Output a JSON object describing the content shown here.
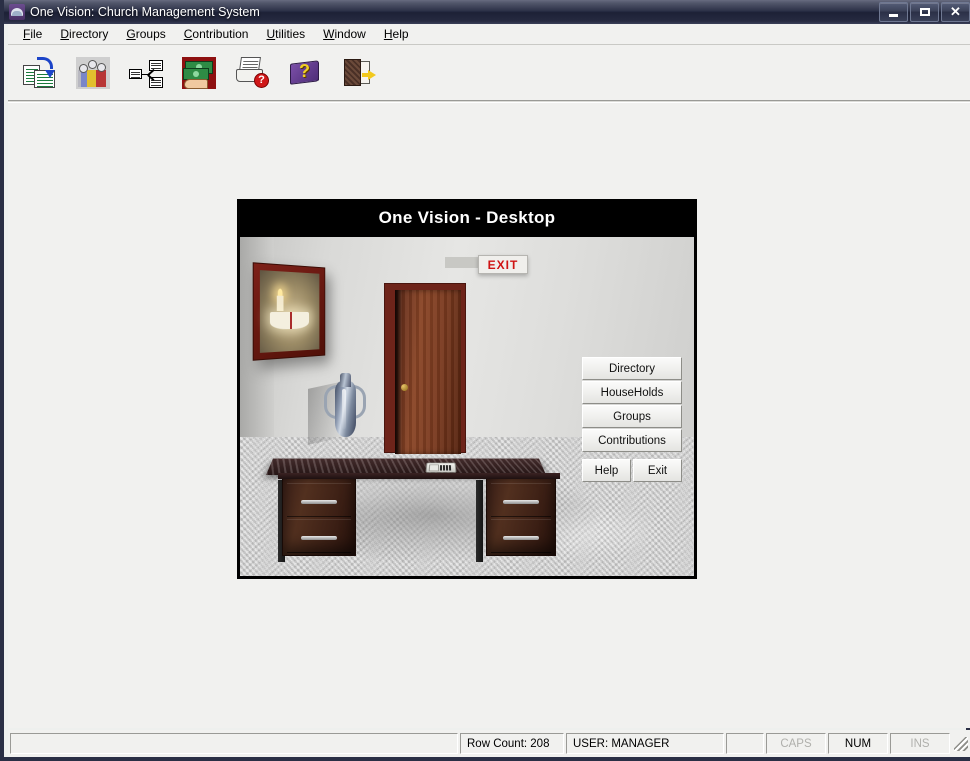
{
  "window": {
    "title": "One Vision:  Church Management System",
    "app_icon": "church-arch-icon",
    "controls": {
      "minimize_label": "Minimize",
      "maximize_label": "Maximize",
      "close_label": "Close"
    }
  },
  "menu": {
    "items": [
      {
        "label": "File",
        "accel": "F",
        "rest": "ile"
      },
      {
        "label": "Directory",
        "accel": "D",
        "rest": "irectory"
      },
      {
        "label": "Groups",
        "accel": "G",
        "rest": "roups"
      },
      {
        "label": "Contribution",
        "accel": "C",
        "rest": "ontribution"
      },
      {
        "label": "Utilities",
        "accel": "U",
        "rest": "tilities"
      },
      {
        "label": "Window",
        "accel": "W",
        "rest": "indow"
      },
      {
        "label": "Help",
        "accel": "H",
        "rest": "elp"
      }
    ]
  },
  "toolbar": {
    "buttons": [
      {
        "icon": "switch-records-icon",
        "tooltip": "Directory"
      },
      {
        "icon": "people-group-icon",
        "tooltip": "Households"
      },
      {
        "icon": "org-chart-icon",
        "tooltip": "Groups"
      },
      {
        "icon": "money-hand-icon",
        "tooltip": "Contributions"
      },
      {
        "icon": "report-question-icon",
        "tooltip": "Reports"
      },
      {
        "icon": "help-book-icon",
        "tooltip": "Help"
      },
      {
        "icon": "exit-door-icon",
        "tooltip": "Exit"
      }
    ]
  },
  "desktop_window": {
    "caption": "One Vision - Desktop",
    "scene": {
      "exit_sign": "EXIT",
      "picture_subject": "candle-and-open-bible",
      "objects": [
        "framed-picture",
        "exit-sign",
        "wooden-door",
        "vase",
        "desk",
        "telephone"
      ]
    },
    "panel": {
      "buttons": [
        {
          "label": "Directory"
        },
        {
          "label": "HouseHolds"
        },
        {
          "label": "Groups"
        },
        {
          "label": "Contributions"
        }
      ],
      "footer_buttons": [
        {
          "label": "Help"
        },
        {
          "label": "Exit"
        }
      ]
    }
  },
  "status_bar": {
    "message": "",
    "row_count": "Row Count: 208",
    "user": "USER:  MANAGER",
    "blank": "",
    "caps": "CAPS",
    "num": "NUM",
    "ins": "INS"
  },
  "colors": {
    "titlebar_dark": "#1d2136",
    "client_bg": "#f1f1ef",
    "caption_black": "#000000",
    "exit_red": "#cf1414",
    "accent_purple": "#4e2d78"
  }
}
